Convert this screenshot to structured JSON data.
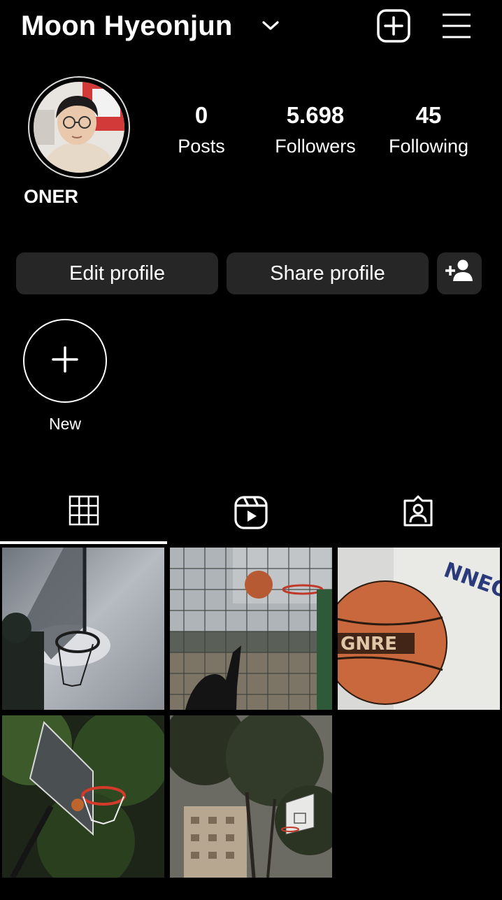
{
  "header": {
    "username": "Moon Hyeonjun",
    "username_dropdown_icon": "chevron-down-icon",
    "new_post_icon": "plus-square-icon",
    "menu_icon": "hamburger-menu-icon"
  },
  "profile": {
    "display_name": "ONER",
    "stats": [
      {
        "value": "0",
        "label": "Posts"
      },
      {
        "value": "5.698",
        "label": "Followers"
      },
      {
        "value": "45",
        "label": "Following"
      }
    ]
  },
  "actions": {
    "edit_label": "Edit profile",
    "share_label": "Share profile",
    "add_person_icon": "person-add-icon"
  },
  "highlights": {
    "new_label": "New",
    "new_icon": "plus-icon"
  },
  "tabs": [
    {
      "icon": "grid-icon",
      "active": true
    },
    {
      "icon": "reels-icon",
      "active": false
    },
    {
      "icon": "tagged-person-icon",
      "active": false
    }
  ],
  "grid": {
    "photos": [
      {
        "subject": "basketball hoop against cloudy sky"
      },
      {
        "subject": "ball thrown toward hoop behind fence"
      },
      {
        "subject": "close-up of basketball"
      },
      {
        "subject": "hoop at night with trees"
      },
      {
        "subject": "backboard among tall trees"
      }
    ]
  },
  "colors": {
    "background": "#000000",
    "button": "#262626",
    "text": "#ffffff"
  }
}
